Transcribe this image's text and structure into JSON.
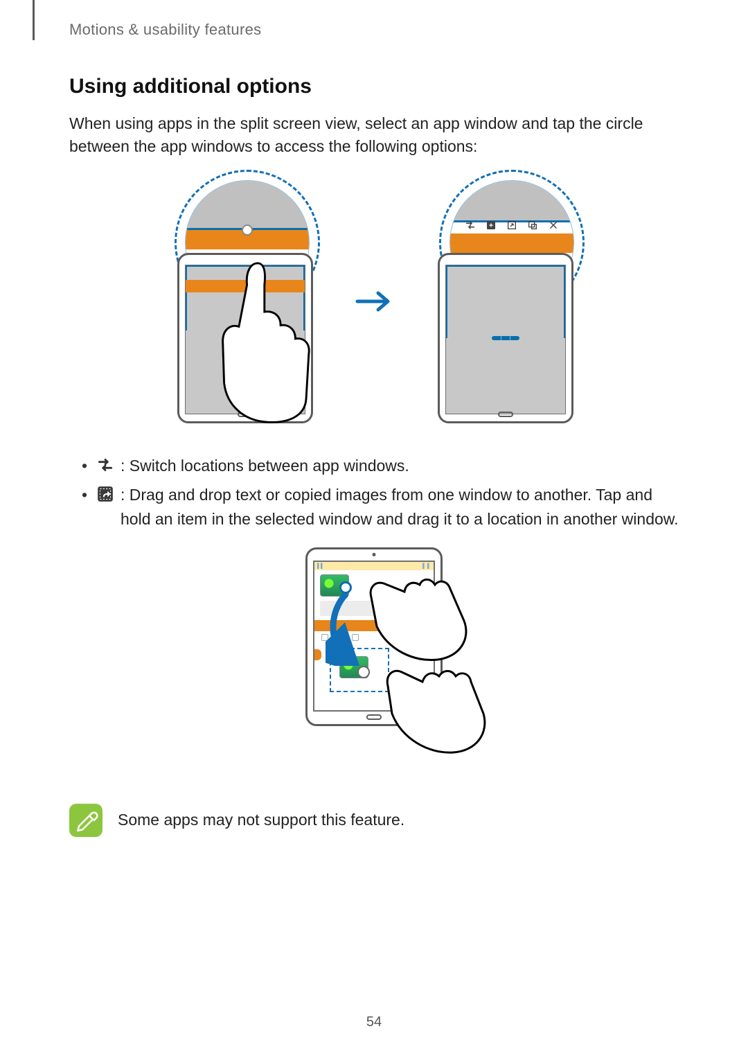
{
  "breadcrumb": "Motions & usability features",
  "heading": "Using additional options",
  "intro": "When using apps in the split screen view, select an app window and tap the circle between the app windows to access the following options:",
  "bullets": [
    {
      "icon": "switch-windows-icon",
      "text": ": Switch locations between app windows."
    },
    {
      "icon": "drag-content-icon",
      "text": ": Drag and drop text or copied images from one window to another. Tap and hold an item in the selected window and drag it to a location in another window."
    }
  ],
  "note": "Some apps may not support this feature.",
  "page_number": "54"
}
